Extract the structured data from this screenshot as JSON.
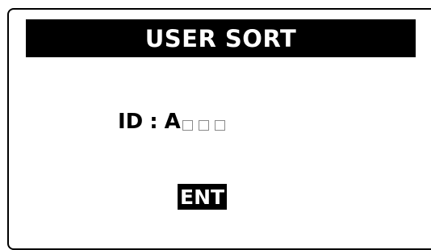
{
  "screen": {
    "title": "USER SORT",
    "id_field": {
      "label": "ID",
      "separator": ":",
      "entered_value": "A",
      "empty_slot_count": 3
    },
    "enter_button_label": "ENT"
  },
  "colors": {
    "title_background": "#000000",
    "title_text": "#ffffff",
    "frame": "#000000",
    "empty_slot_border": "#8a8a8a"
  }
}
